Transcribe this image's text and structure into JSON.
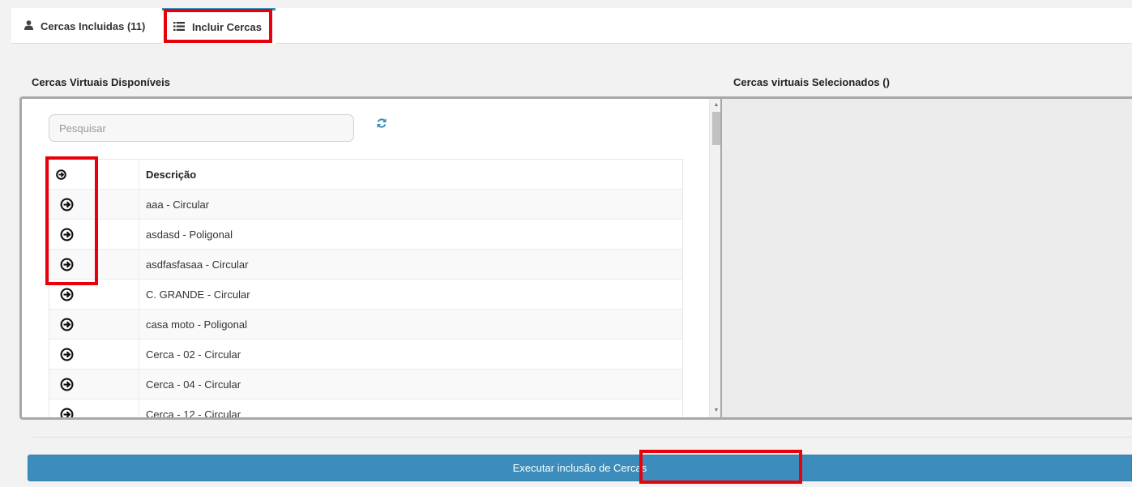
{
  "tabs": {
    "included_label": "Cercas Incluidas (11)",
    "include_label": "Incluir Cercas",
    "included_icon": "user-icon",
    "include_icon": "list-icon",
    "active_border_color": "#3c8dbc"
  },
  "available": {
    "title": "Cercas Virtuais Disponíveis",
    "search_placeholder": "Pesquisar",
    "refresh_icon": "refresh-icon",
    "column_header": "Descrição",
    "header_icon": "arrow-circle-right-icon",
    "rows": [
      "aaa - Circular",
      "asdasd - Poligonal",
      "asdfasfasaa - Circular",
      "C. GRANDE - Circular",
      "casa moto - Poligonal",
      "Cerca - 02 - Circular",
      "Cerca - 04 - Circular",
      "Cerca - 12 - Circular"
    ],
    "row_icon": "arrow-circle-right-icon"
  },
  "selected": {
    "title": "Cercas virtuais Selecionados ()"
  },
  "actions": {
    "execute_label": "Executar inclusão de Cercas",
    "button_color": "#3c8dbc"
  },
  "highlight_color": "#e8000b"
}
